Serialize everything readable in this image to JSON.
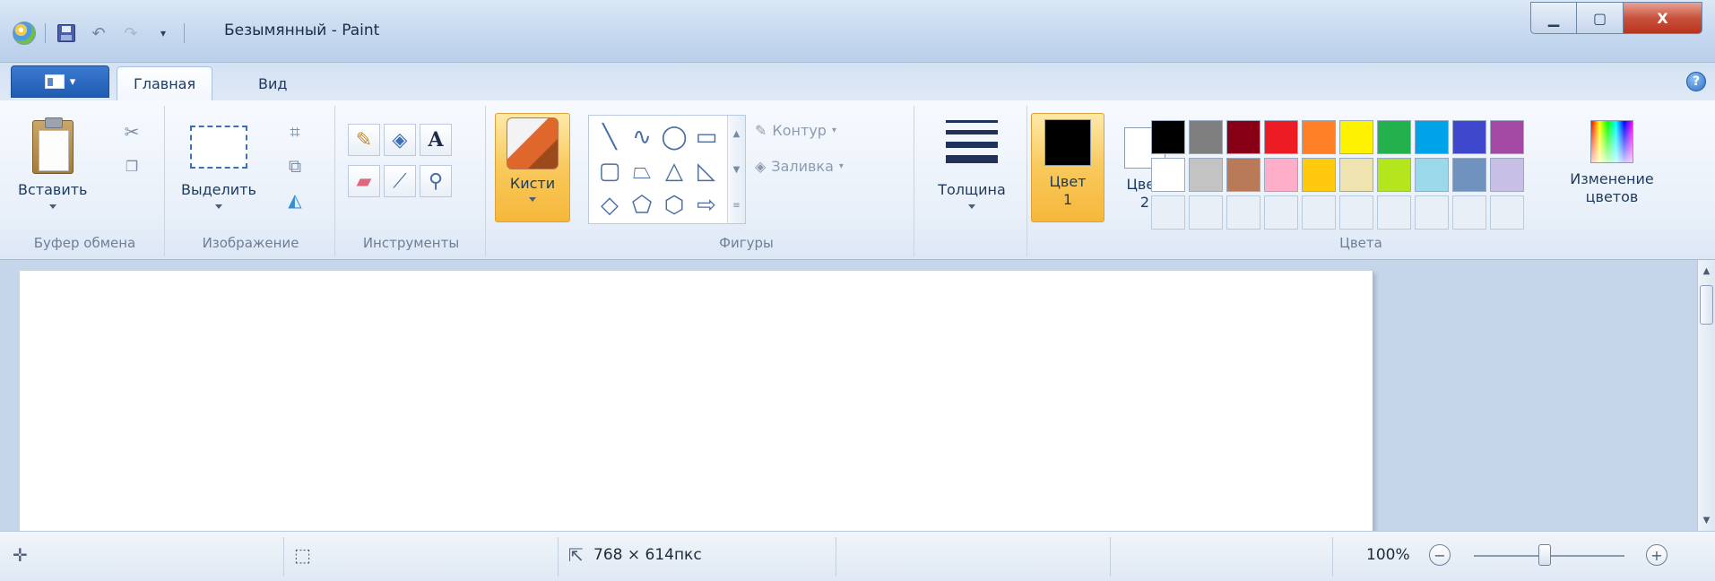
{
  "window": {
    "title": "Безымянный - Paint",
    "min_label": "▁",
    "max_label": "▢",
    "close_label": "X"
  },
  "tabs": {
    "home": "Главная",
    "view": "Вид"
  },
  "help_label": "?",
  "clipboard": {
    "paste": "Вставить",
    "group": "Буфер обмена"
  },
  "image": {
    "select": "Выделить",
    "group": "Изображение"
  },
  "tools": {
    "group": "Инструменты"
  },
  "brushes": {
    "label": "Кисти"
  },
  "shapes": {
    "outline": "Контур",
    "fill": "Заливка",
    "group": "Фигуры"
  },
  "size": {
    "label": "Толщина"
  },
  "colors": {
    "color1_line1": "Цвет",
    "color1_line2": "1",
    "color2_line1": "Цвет",
    "color2_line2": "2",
    "edit_line1": "Изменение",
    "edit_line2": "цветов",
    "group": "Цвета",
    "color1": "#000000",
    "color2": "#ffffff",
    "palette_row1": [
      "#000000",
      "#7f7f7f",
      "#880015",
      "#ed1c24",
      "#ff7f27",
      "#fff200",
      "#22b14c",
      "#00a2e8",
      "#3f48cc",
      "#a349a4"
    ],
    "palette_row2": [
      "#ffffff",
      "#c3c3c3",
      "#b97a57",
      "#ffaec9",
      "#ffc90e",
      "#efe4b0",
      "#b5e61d",
      "#99d9ea",
      "#7092be",
      "#c8bfe7"
    ]
  },
  "status": {
    "image_size": "768 × 614пкс",
    "zoom": "100%"
  },
  "icons": {
    "app": "paint-app-icon",
    "save": "save-icon",
    "undo": "undo-icon",
    "redo": "redo-icon",
    "customize": "customize-qat-icon",
    "cut": "scissors-icon",
    "copy": "copy-icon",
    "crop": "crop-icon",
    "resize": "resize-icon",
    "rotate": "rotate-icon",
    "pencil": "pencil-icon",
    "fill": "bucket-icon",
    "text": "text-icon",
    "eraser": "eraser-icon",
    "picker": "eyedropper-icon",
    "magnifier": "magnifier-icon",
    "cursor_pos": "cursor-position-icon",
    "selection_size": "selection-size-icon",
    "canvas_size": "canvas-size-icon"
  }
}
